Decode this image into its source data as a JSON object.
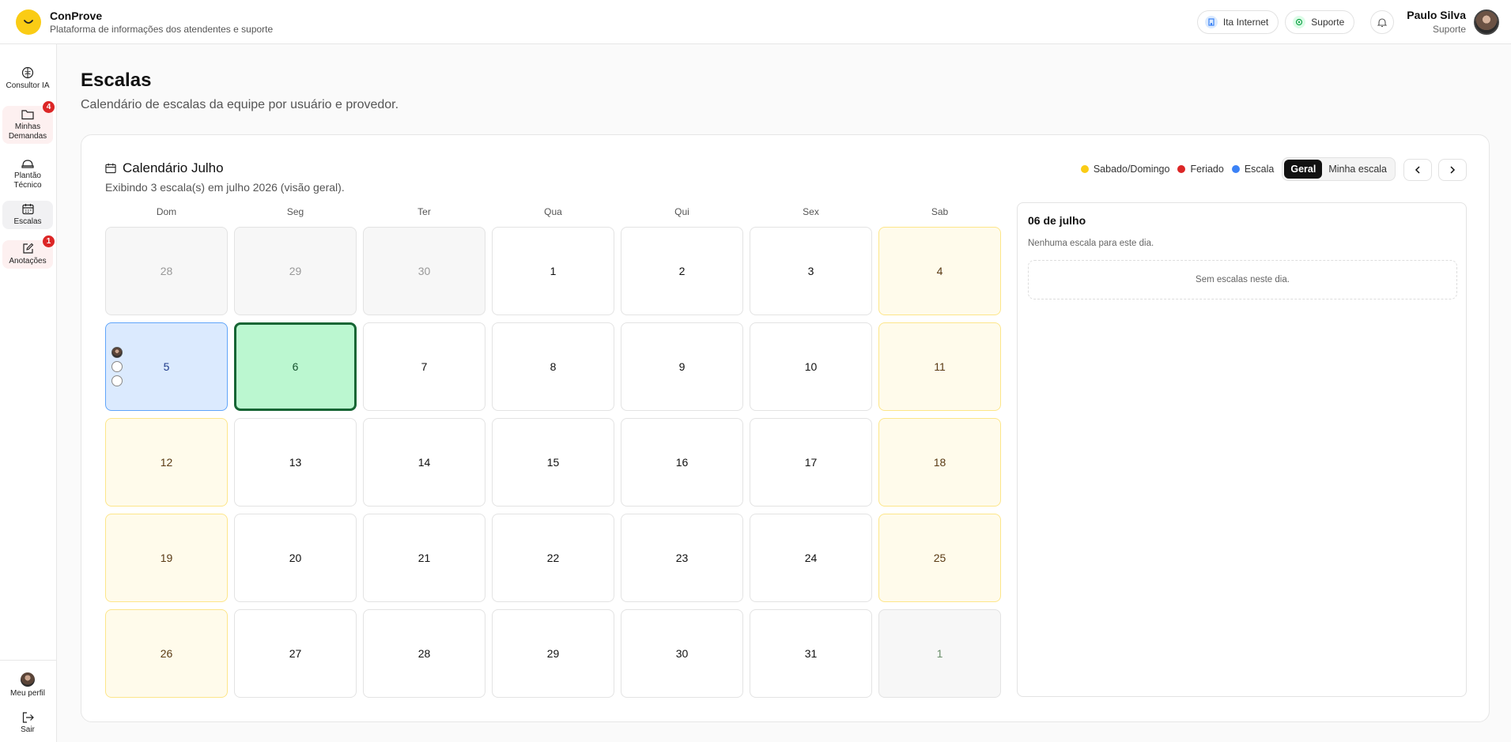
{
  "app": {
    "name": "ConProve",
    "subtitle": "Plataforma de informações dos atendentes e suporte"
  },
  "header": {
    "pills": [
      {
        "label": "Ita Internet",
        "icon": "building-icon",
        "color": "#3b82f6"
      },
      {
        "label": "Suporte",
        "icon": "headset-icon",
        "color": "#16a34a"
      }
    ],
    "user": {
      "name": "Paulo Silva",
      "role": "Suporte"
    }
  },
  "sidebar": {
    "items": [
      {
        "label": "Consultor IA",
        "icon": "brain-icon"
      },
      {
        "label": "Minhas Demandas",
        "icon": "folder-icon",
        "badge": "4"
      },
      {
        "label": "Plantão Técnico",
        "icon": "helmet-icon"
      },
      {
        "label": "Escalas",
        "icon": "calendar-icon"
      },
      {
        "label": "Anotações",
        "icon": "edit-note-icon",
        "badge": "1"
      }
    ],
    "profile_label": "Meu perfil",
    "logout_label": "Sair"
  },
  "page": {
    "title": "Escalas",
    "subtitle": "Calendário de escalas da equipe por usuário e provedor."
  },
  "calendar": {
    "title": "Calendário Julho",
    "summary": "Exibindo 3 escala(s) em julho 2026 (visão geral).",
    "legend": [
      {
        "label": "Sabado/Domingo",
        "color": "#facc15"
      },
      {
        "label": "Feriado",
        "color": "#dc2626"
      },
      {
        "label": "Escala",
        "color": "#3b82f6"
      }
    ],
    "view_options": [
      "Geral",
      "Minha escala"
    ],
    "active_view": "Geral",
    "weekdays": [
      "Dom",
      "Seg",
      "Ter",
      "Qua",
      "Qui",
      "Sex",
      "Sab"
    ],
    "weeks": [
      [
        "28",
        "29",
        "30",
        "1",
        "2",
        "3",
        "4"
      ],
      [
        "5",
        "6",
        "7",
        "8",
        "9",
        "10",
        "11"
      ],
      [
        "12",
        "13",
        "14",
        "15",
        "16",
        "17",
        "18"
      ],
      [
        "19",
        "20",
        "21",
        "22",
        "23",
        "24",
        "25"
      ],
      [
        "26",
        "27",
        "28",
        "29",
        "30",
        "31",
        "1"
      ]
    ]
  },
  "detail": {
    "date": "06 de julho",
    "note": "Nenhuma escala para este dia.",
    "empty": "Sem escalas neste dia."
  }
}
